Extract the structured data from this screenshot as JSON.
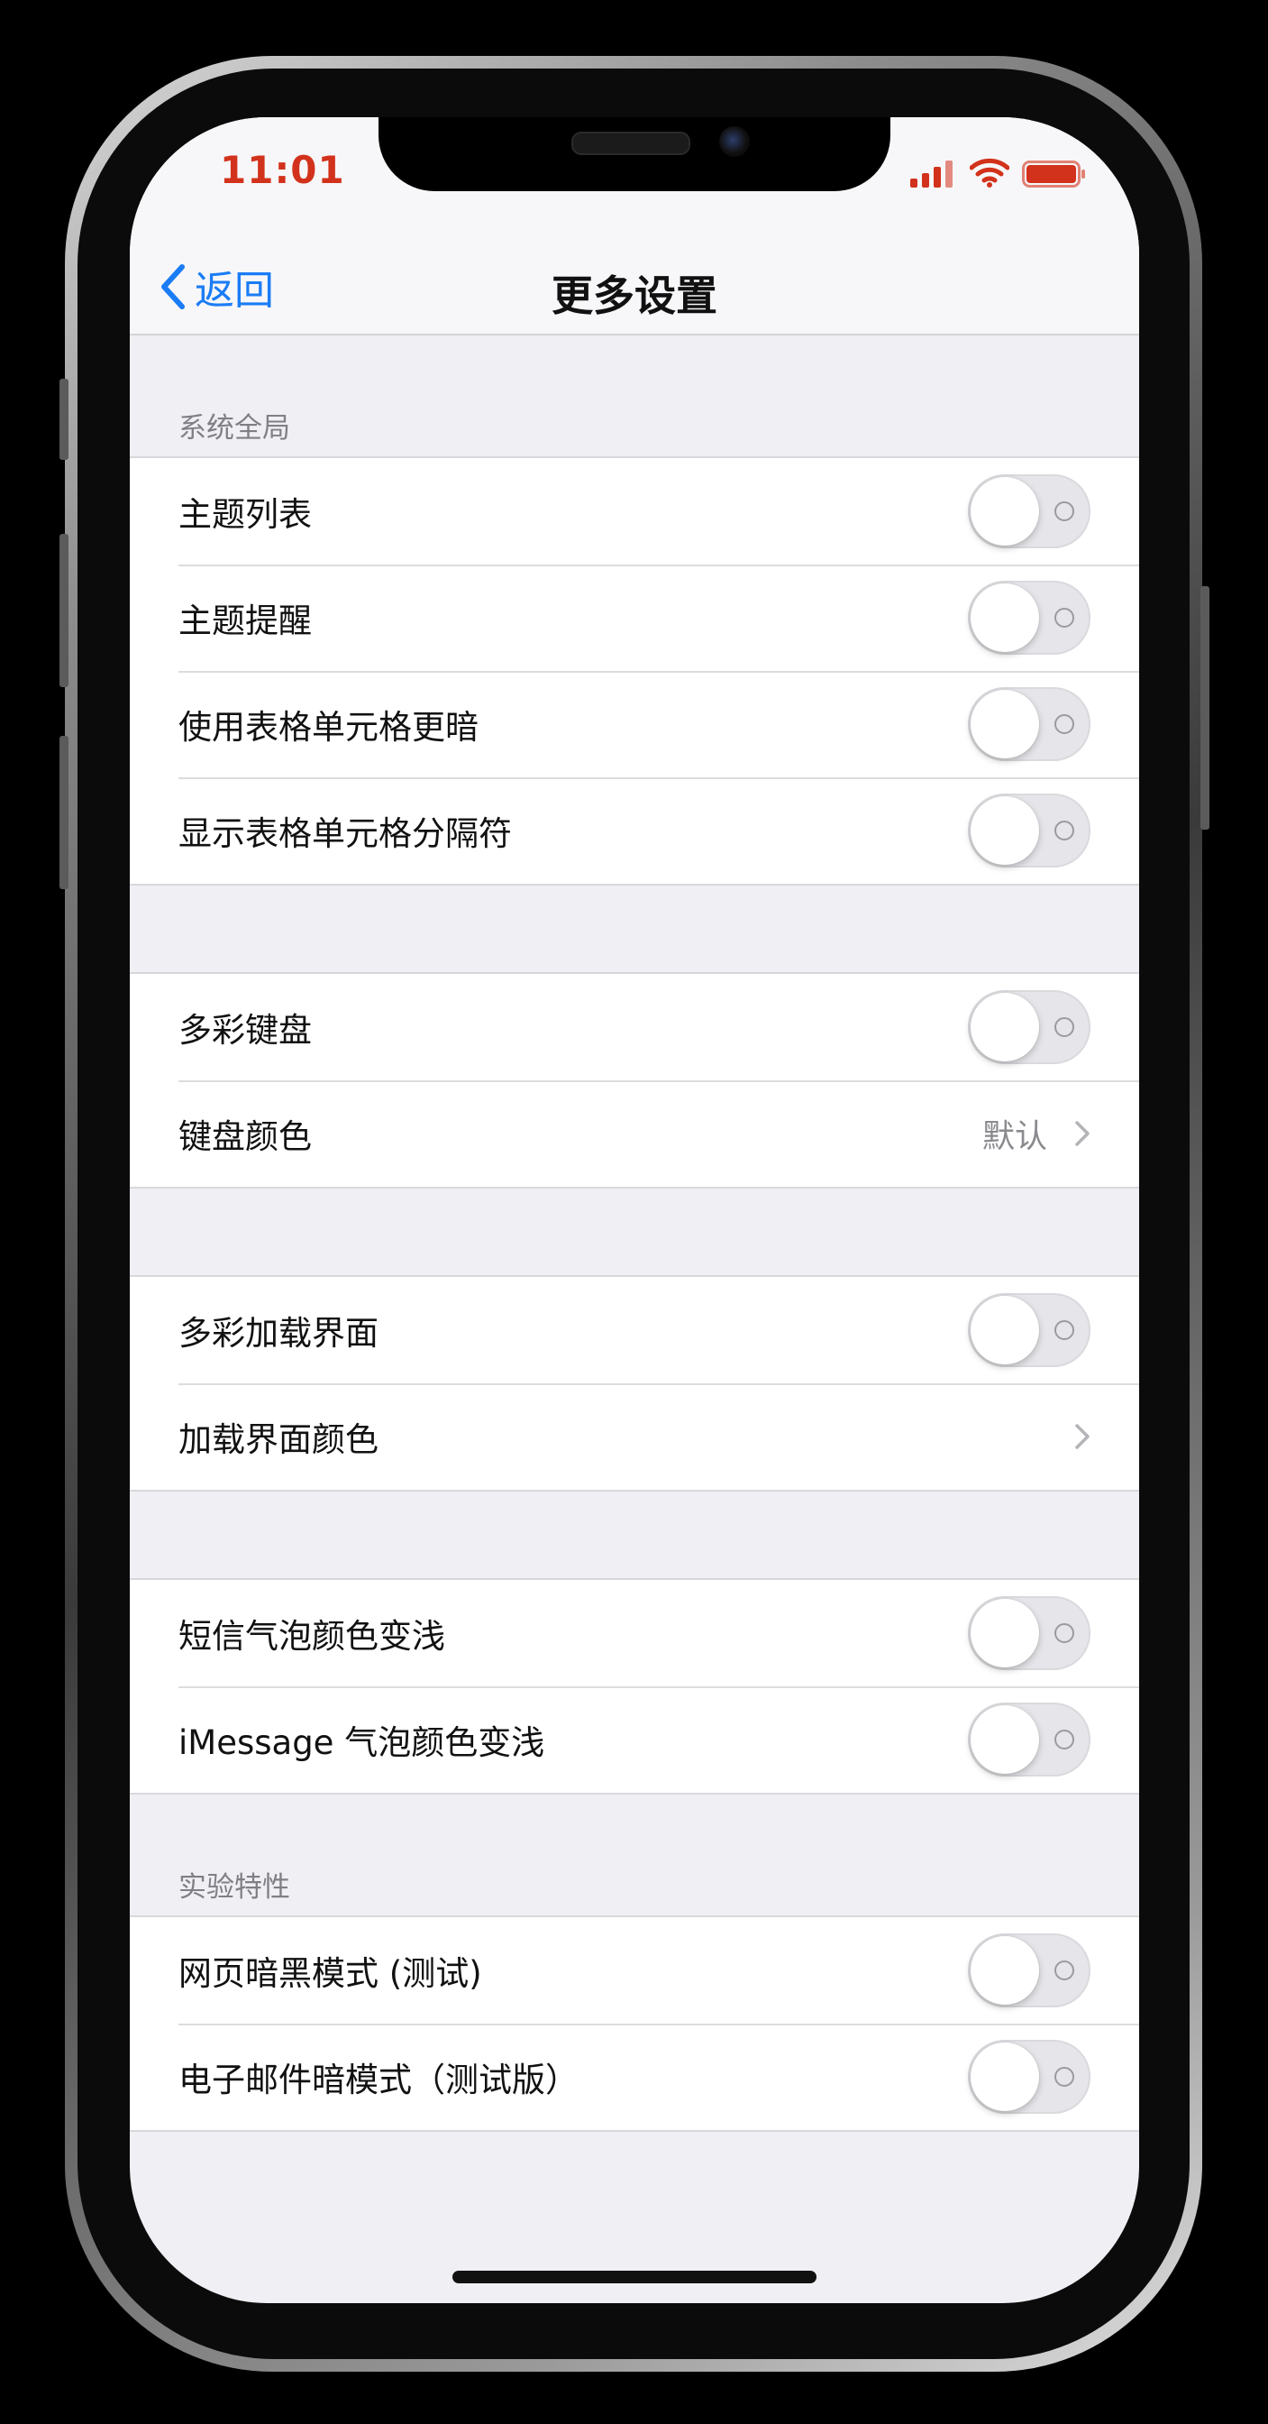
{
  "status_bar": {
    "time": "11:01"
  },
  "nav": {
    "back_label": "返回",
    "title": "更多设置"
  },
  "sections": {
    "system": {
      "header": "系统全局",
      "items": [
        {
          "label": "主题列表",
          "toggle": false
        },
        {
          "label": "主题提醒",
          "toggle": false
        },
        {
          "label": "使用表格单元格更暗",
          "toggle": false
        },
        {
          "label": "显示表格单元格分隔符",
          "toggle": false
        }
      ]
    },
    "keyboard": {
      "items": [
        {
          "label": "多彩键盘",
          "toggle": false
        },
        {
          "label": "键盘颜色",
          "value": "默认"
        }
      ]
    },
    "loading": {
      "items": [
        {
          "label": "多彩加载界面",
          "toggle": false
        },
        {
          "label": "加载界面颜色"
        }
      ]
    },
    "messages": {
      "items": [
        {
          "label": "短信气泡颜色变浅",
          "toggle": false
        },
        {
          "label": "iMessage 气泡颜色变浅",
          "toggle": false
        }
      ]
    },
    "experimental": {
      "header": "实验特性",
      "items": [
        {
          "label": "网页暗黑模式 (测试)",
          "toggle": false
        },
        {
          "label": "电子邮件暗模式（测试版）",
          "toggle": false
        }
      ]
    }
  },
  "colors": {
    "status_accent": "#d2321b",
    "link_blue": "#1a7cf5",
    "grouped_background": "#efeff4"
  }
}
